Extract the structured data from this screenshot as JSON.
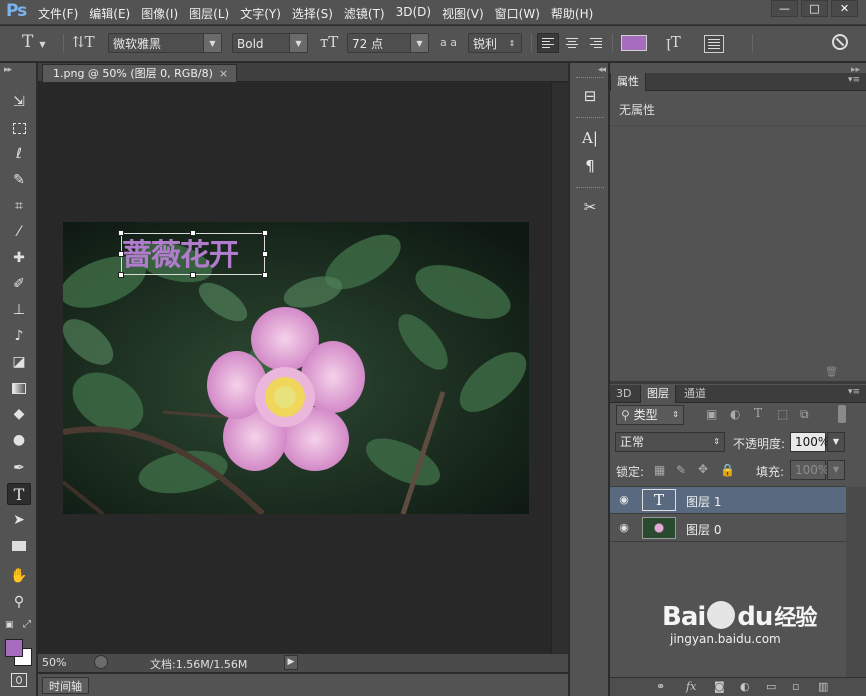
{
  "app": {
    "logo": "Ps"
  },
  "menu": [
    "文件(F)",
    "编辑(E)",
    "图像(I)",
    "图层(L)",
    "文字(Y)",
    "选择(S)",
    "滤镜(T)",
    "3D(D)",
    "视图(V)",
    "窗口(W)",
    "帮助(H)"
  ],
  "window_controls": {
    "minimize": "—",
    "maximize": "□",
    "close": "✕"
  },
  "options_bar": {
    "font_family": "微软雅黑",
    "font_style": "Bold",
    "font_size": "72 点",
    "anti_alias_icon_text": "a a",
    "anti_alias": "锐利",
    "text_color": "#a66dbf"
  },
  "document": {
    "tab_title": "1.png @ 50% (图层 0, RGB/8)",
    "tab_close": "×",
    "text_content": "蔷薇花开",
    "zoom": "50%",
    "doc_info": "文档:1.56M/1.56M"
  },
  "timeline": {
    "label": "时间轴"
  },
  "properties_panel": {
    "tab": "属性",
    "empty_text": "无属性"
  },
  "layers_panel": {
    "tabs": [
      "3D",
      "图层",
      "通道"
    ],
    "filter_label": "类型",
    "blend_mode": "正常",
    "opacity_label": "不透明度:",
    "opacity_value": "100%",
    "lock_label": "锁定:",
    "fill_label": "填充:",
    "fill_value": "100%",
    "layers": [
      {
        "name": "图层 1",
        "type": "text",
        "selected": true
      },
      {
        "name": "图层 0",
        "type": "image",
        "selected": false
      }
    ]
  },
  "watermark": {
    "brand": "Bai",
    "brand2": "du",
    "brand_cn": "经验",
    "url": "jingyan.baidu.com"
  },
  "colors": {
    "foreground": "#a66dbf",
    "background": "#ffffff",
    "panel_bg": "#535353",
    "selected_layer": "#596a80"
  }
}
